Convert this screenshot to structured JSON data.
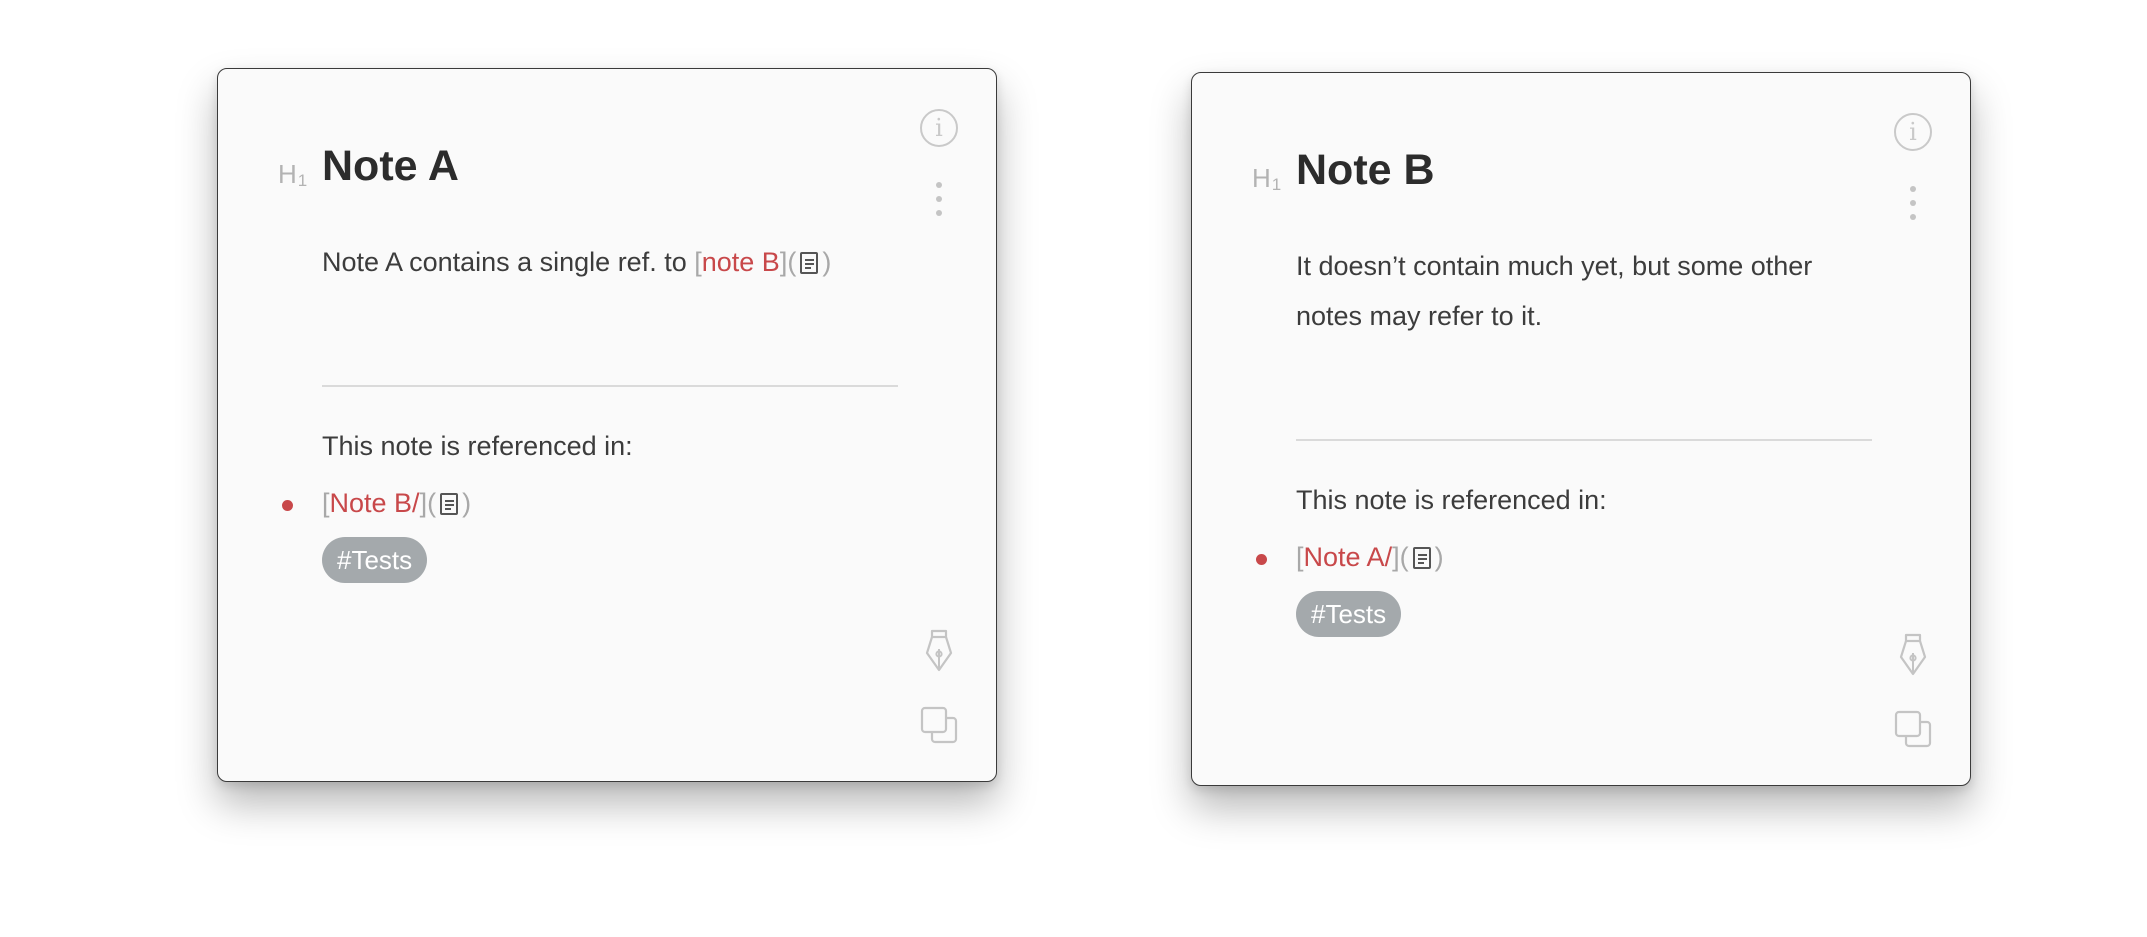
{
  "windows": [
    {
      "heading_marker": "H",
      "heading_level": "1",
      "title": "Note A",
      "body_prefix": "Note A contains a single ref. to ",
      "body_link_open": "[",
      "body_link_text": "note B",
      "body_link_mid": "](",
      "body_link_close": ")",
      "references_heading": "This note is referenced in:",
      "reference_open": "[",
      "reference_text": "Note B/",
      "reference_mid": "](",
      "reference_close": ")",
      "tag": "#Tests",
      "info_glyph": "i"
    },
    {
      "heading_marker": "H",
      "heading_level": "1",
      "title": "Note B",
      "body_text": "It doesn’t contain much yet, but some other notes may refer to it.",
      "references_heading": "This note is referenced in:",
      "reference_open": "[",
      "reference_text": "Note A/",
      "reference_mid": "](",
      "reference_close": ")",
      "tag": "#Tests",
      "info_glyph": "i"
    }
  ],
  "icons": {
    "info": "info-icon",
    "more": "more-vertical-icon",
    "pen": "pen-icon",
    "duplicate": "duplicate-icon",
    "note": "note-icon"
  },
  "colors": {
    "link": "#c8484a",
    "tag_background": "#a4a9ac",
    "window_background": "#fafafa"
  }
}
